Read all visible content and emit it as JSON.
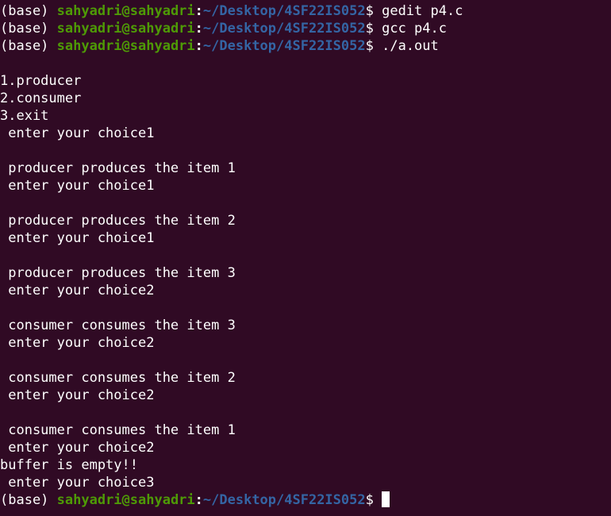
{
  "terminal": {
    "prompt": {
      "env": "(base) ",
      "user_host": "sahyadri@sahyadri",
      "colon": ":",
      "path": "~/Desktop/4SF22IS052",
      "symbol": "$ "
    },
    "lines": [
      {
        "kind": "prompt",
        "command": "gedit p4.c"
      },
      {
        "kind": "prompt",
        "command": "gcc p4.c"
      },
      {
        "kind": "prompt",
        "command": "./a.out"
      },
      {
        "kind": "text",
        "text": ""
      },
      {
        "kind": "text",
        "text": "1.producer"
      },
      {
        "kind": "text",
        "text": "2.consumer"
      },
      {
        "kind": "text",
        "text": "3.exit"
      },
      {
        "kind": "text",
        "text": " enter your choice1"
      },
      {
        "kind": "text",
        "text": ""
      },
      {
        "kind": "text",
        "text": " producer produces the item 1"
      },
      {
        "kind": "text",
        "text": " enter your choice1"
      },
      {
        "kind": "text",
        "text": ""
      },
      {
        "kind": "text",
        "text": " producer produces the item 2"
      },
      {
        "kind": "text",
        "text": " enter your choice1"
      },
      {
        "kind": "text",
        "text": ""
      },
      {
        "kind": "text",
        "text": " producer produces the item 3"
      },
      {
        "kind": "text",
        "text": " enter your choice2"
      },
      {
        "kind": "text",
        "text": ""
      },
      {
        "kind": "text",
        "text": " consumer consumes the item 3"
      },
      {
        "kind": "text",
        "text": " enter your choice2"
      },
      {
        "kind": "text",
        "text": ""
      },
      {
        "kind": "text",
        "text": " consumer consumes the item 2"
      },
      {
        "kind": "text",
        "text": " enter your choice2"
      },
      {
        "kind": "text",
        "text": ""
      },
      {
        "kind": "text",
        "text": " consumer consumes the item 1"
      },
      {
        "kind": "text",
        "text": " enter your choice2"
      },
      {
        "kind": "text",
        "text": "buffer is empty!!"
      },
      {
        "kind": "text",
        "text": " enter your choice3"
      },
      {
        "kind": "prompt",
        "command": "",
        "cursor": true
      }
    ]
  }
}
